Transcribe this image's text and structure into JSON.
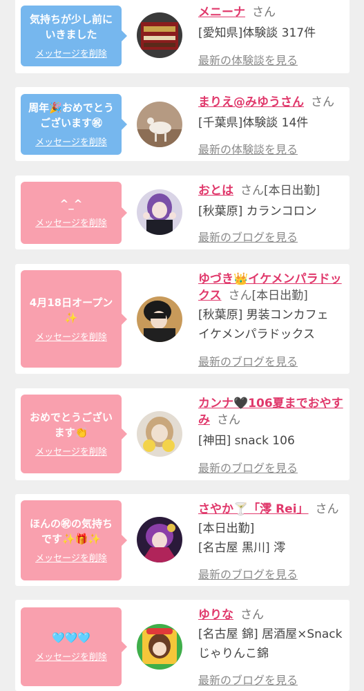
{
  "delete_label": "メッセージを削除",
  "items": [
    {
      "bubble_text": "気持ちが少し前に\nいきました",
      "bubble_color": "#76b7ee",
      "name": "メニーナ",
      "status": "",
      "san": "さん",
      "details": [
        "[愛知県]体験談 317件"
      ],
      "latest_link": "最新の体験談を見る"
    },
    {
      "bubble_text": "周年🎉おめでとう\nございます㊗",
      "bubble_color": "#76b7ee",
      "name": "まりえ@みゆうさん",
      "status": "",
      "san": "さん",
      "details": [
        "[千葉県]体験談 14件"
      ],
      "latest_link": "最新の体験談を見る"
    },
    {
      "bubble_text": "^_^",
      "bubble_color": "#f9a0ae",
      "name": "おとは",
      "status": "[本日出勤]",
      "san": "さん",
      "details": [
        "[秋葉原] カランコロン"
      ],
      "latest_link": "最新のブログを見る"
    },
    {
      "bubble_text": "4月18日オープン\n✨",
      "bubble_color": "#f9a0ae",
      "name": "ゆづき👑イケメンパラドックス",
      "status": "[本日出勤]",
      "san": "さん",
      "details": [
        "[秋葉原] 男装コンカフェ",
        "イケメンパラドックス"
      ],
      "latest_link": "最新のブログを見る"
    },
    {
      "bubble_text": "おめでとうござい\nます👏",
      "bubble_color": "#f9a0ae",
      "name": "カンナ🖤106夏までおやすみ",
      "status": "",
      "san": "さん",
      "details": [
        "[神田] snack 106"
      ],
      "latest_link": "最新のブログを見る"
    },
    {
      "bubble_text": "ほんの㊗の気持ち\nです✨🎁✨",
      "bubble_color": "#f9a0ae",
      "name": "さやか🍸「澪 Rei」",
      "status": "",
      "san": "さん",
      "details": [
        "[本日出勤]",
        "[名古屋 黒川] 澪"
      ],
      "latest_link": "最新のブログを見る"
    },
    {
      "bubble_text": "🩵🩵🩵",
      "bubble_color": "#f9a0ae",
      "name": "ゆりな",
      "status": "",
      "san": "さん",
      "details": [
        "[名古屋 錦] 居酒屋×Snack",
        "じゃりんこ錦"
      ],
      "latest_link": "最新のブログを見る"
    }
  ]
}
